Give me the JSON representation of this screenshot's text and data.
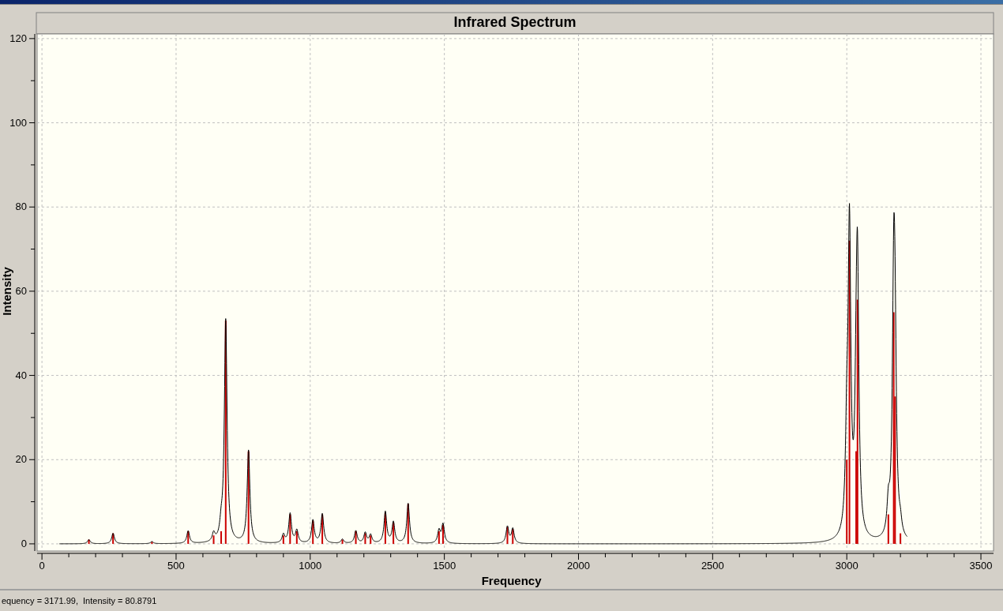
{
  "chart": {
    "chart_data": {
      "type": "bar",
      "grid": true,
      "title": "Infrared Spectrum",
      "xlabel": "Frequency",
      "ylabel": "Intensity",
      "x": [
        175,
        265,
        410,
        545,
        640,
        668,
        685,
        770,
        900,
        925,
        950,
        1010,
        1045,
        1120,
        1170,
        1205,
        1225,
        1280,
        1310,
        1365,
        1480,
        1495,
        1735,
        1755,
        3000,
        3010,
        3035,
        3040,
        3155,
        3175,
        3180,
        3200
      ],
      "series": [
        {
          "color": "#cc0000",
          "values": [
            1,
            2.5,
            0.5,
            3,
            2,
            3,
            53,
            22,
            2,
            7,
            3,
            5.5,
            7,
            1,
            3,
            2.5,
            2,
            7.5,
            5,
            9.5,
            3,
            4.5,
            4,
            3.5,
            20,
            72,
            22,
            58,
            7,
            55,
            35,
            2.5
          ]
        }
      ],
      "xlim": [
        -18,
        3547
      ],
      "ylim": [
        -1.7,
        121.1
      ],
      "xticks": [
        0,
        500,
        1000,
        1500,
        2000,
        2500,
        3000,
        3500
      ],
      "yticks": [
        0,
        20,
        40,
        60,
        80,
        100,
        120
      ]
    }
  },
  "status_bar": {
    "text": "equency = 3171.99,  Intensity = 80.8791"
  }
}
